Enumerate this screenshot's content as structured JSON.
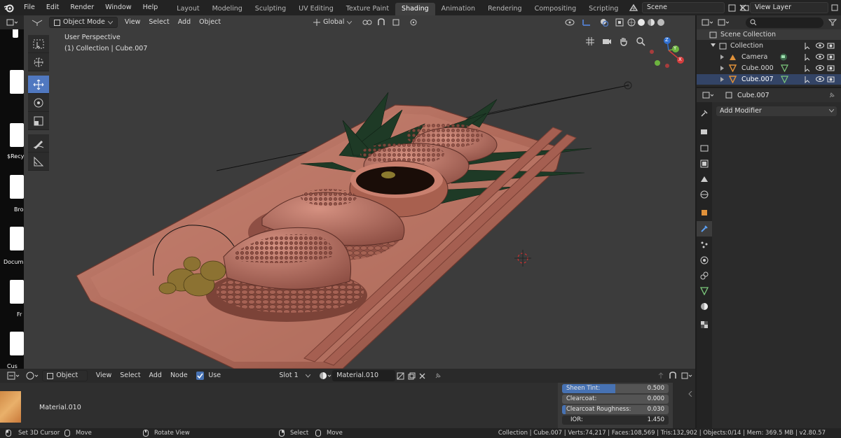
{
  "menubar": {
    "items": [
      "File",
      "Edit",
      "Render",
      "Window",
      "Help"
    ],
    "workspace_tabs": [
      "Layout",
      "Modeling",
      "Sculpting",
      "UV Editing",
      "Texture Paint",
      "Shading",
      "Animation",
      "Rendering",
      "Compositing",
      "Scripting"
    ],
    "active_tab": "Shading",
    "add_tab": "+",
    "scene": "Scene",
    "view_layer": "View Layer"
  },
  "desktop": {
    "labels": [
      "$Recy",
      "Bro",
      "Docum",
      "Fr",
      "Cus"
    ]
  },
  "viewport": {
    "mode": "Object Mode",
    "menus": [
      "View",
      "Select",
      "Add",
      "Object"
    ],
    "transform_orientation": "Global",
    "perspective_label": "User Perspective",
    "collection_label": "(1) Collection | Cube.007",
    "gizmo_axes": [
      "X",
      "Y",
      "Z"
    ]
  },
  "outliner": {
    "root": "Scene Collection",
    "collection": "Collection",
    "items": [
      "Camera",
      "Cube.000",
      "Cube.007"
    ],
    "search_placeholder": ""
  },
  "properties": {
    "object_name": "Cube.007",
    "add_modifier": "Add Modifier"
  },
  "shader_editor": {
    "object_menu": "Object",
    "menus": [
      "View",
      "Select",
      "Add",
      "Node"
    ],
    "use_nodes_label": "Use Nodes",
    "use_nodes_checked": true,
    "slot": "Slot 1",
    "material": "Material.010",
    "node_label": "Material.010",
    "props": [
      {
        "label": "Sheen Tint:",
        "value": "0.500",
        "fill": 0.5
      },
      {
        "label": "Clearcoat:",
        "value": "0.000",
        "fill": 0.0
      },
      {
        "label": "Clearcoat Roughness:",
        "value": "0.030",
        "fill": 0.03
      },
      {
        "label": "IOR:",
        "value": "1.450",
        "fill": 0.0
      }
    ]
  },
  "statusbar": {
    "set_cursor": "Set 3D Cursor",
    "move": "Move",
    "rotate": "Rotate View",
    "select": "Select",
    "move2": "Move",
    "stats": "Collection | Cube.007 | Verts:74,217 | Faces:108,569 | Tris:132,902 | Objects:0/14 | Mem: 369.5 MB | v2.80.57"
  },
  "colors": {
    "accent": "#5078c0",
    "active_tab_bg": "#3f3f3f",
    "viewport_bg": "#3c3c3c",
    "tray": "#b96f5f",
    "leaf": "#1f3b26"
  }
}
